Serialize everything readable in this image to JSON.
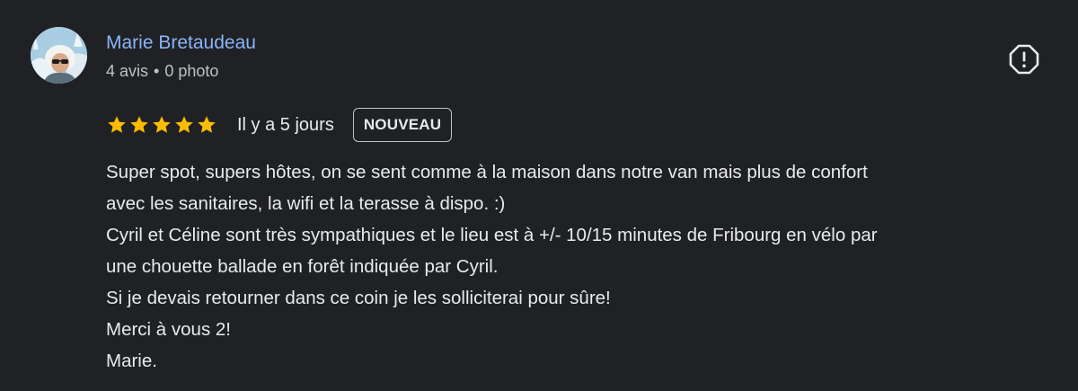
{
  "author": {
    "name": "Marie Bretaudeau",
    "reviews_count": "4 avis",
    "separator": "•",
    "photos_count": "0 photo"
  },
  "rating": {
    "stars": 5,
    "max": 5,
    "star_color": "#fbbc04"
  },
  "date": "Il y a 5 jours",
  "badge": "NOUVEAU",
  "flag_icon": "report-flag-icon",
  "review_lines": [
    "Super spot, supers hôtes, on se sent comme à la maison dans notre van mais plus de confort",
    "avec les sanitaires, la wifi et la terasse à dispo. :)",
    "Cyril et Céline sont très sympathiques et le lieu est à +/- 10/15 minutes de Fribourg en vélo par",
    "une chouette ballade en forêt indiquée par Cyril.",
    "Si je devais retourner dans ce coin je les solliciterai pour sûre!",
    "Merci à vous 2!",
    "Marie."
  ],
  "colors": {
    "background": "#202124",
    "author_link": "#8ab4f8",
    "text": "#e8eaed",
    "secondary_text": "#bdc1c6"
  }
}
